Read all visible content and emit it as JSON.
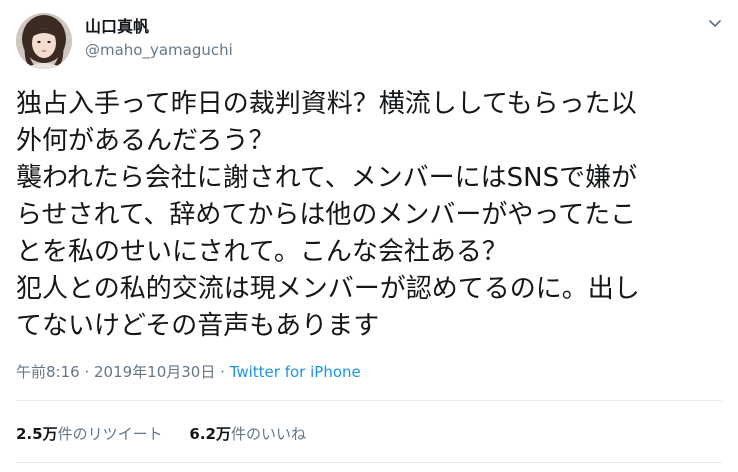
{
  "author": {
    "display_name": "山口真帆",
    "handle": "@maho_yamaguchi"
  },
  "tweet": {
    "lines": [
      "独占入手って昨日の裁判資料？横流ししてもらった以",
      "外何があるんだろう？",
      "襲われたら会社に謝されて、メンバーにはSNSで嫌が",
      "らせされて、辞めてからは他のメンバーがやってたこ",
      "とを私のせいにされて。こんな会社ある？",
      "犯人との私的交流は現メンバーが認めてるのに。出し",
      "てないけどその音声もあります"
    ]
  },
  "meta": {
    "time": "午前8:16",
    "separator": " · ",
    "date": "2019年10月30日",
    "separator2": " · ",
    "source": "Twitter for iPhone"
  },
  "stats": {
    "retweets_count": "2.5万",
    "retweets_unit": "件",
    "retweets_label": "のリツイート",
    "likes_count": "6.2万",
    "likes_unit": "件",
    "likes_label": "のいいね"
  },
  "colors": {
    "text": "#14171a",
    "secondary": "#657786",
    "link": "#1b95e0",
    "divider": "#e6ecf0"
  },
  "icons": {
    "avatar": "profile-photo",
    "caret": "chevron-down-icon"
  }
}
